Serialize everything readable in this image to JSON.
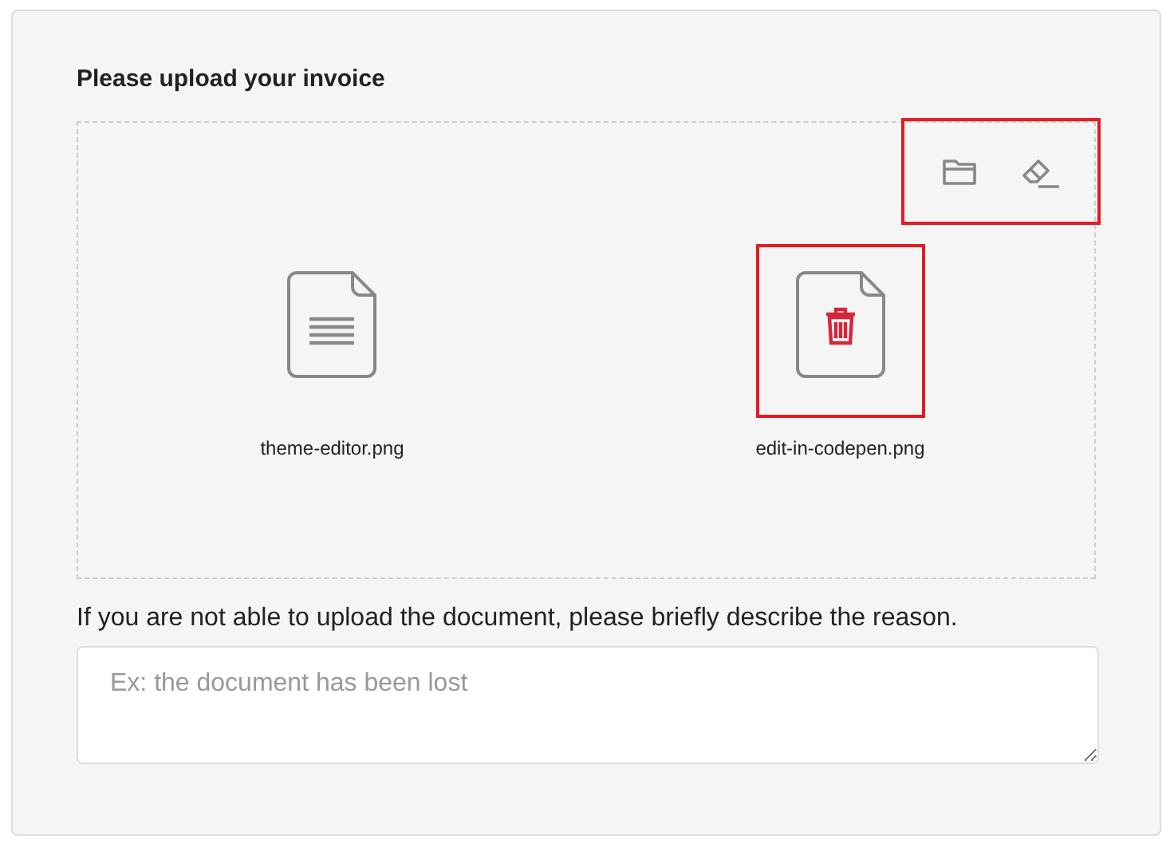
{
  "title": "Please upload your invoice",
  "toolbar": {
    "highlighted": true
  },
  "files": [
    {
      "name": "theme-editor.png",
      "hovered": false,
      "highlighted": false
    },
    {
      "name": "edit-in-codepen.png",
      "hovered": true,
      "highlighted": true
    }
  ],
  "reason": {
    "label": "If you are not able to upload the document, please briefly describe the reason.",
    "placeholder": "Ex: the document has been lost"
  }
}
